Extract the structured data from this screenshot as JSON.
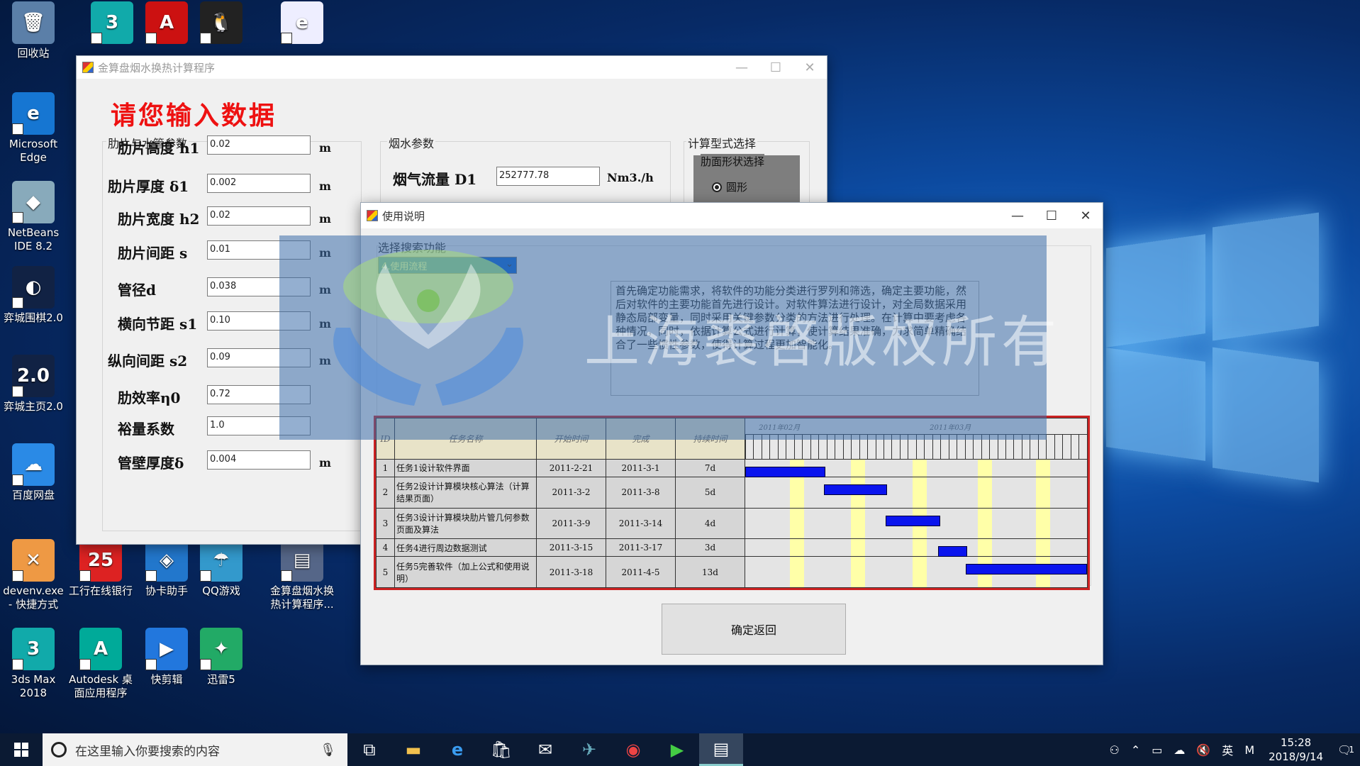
{
  "desktop": {
    "icons": [
      {
        "label": "回收站",
        "glyph": "🗑",
        "color": "#5b7fa8"
      },
      {
        "label": "",
        "glyph": "3",
        "color": "#1aa"
      },
      {
        "label": "",
        "glyph": "A",
        "color": "#c11"
      },
      {
        "label": "",
        "glyph": "🐧",
        "color": "#222"
      },
      {
        "label": "",
        "glyph": "e",
        "color": "#eef"
      },
      {
        "label": "Microsoft Edge",
        "glyph": "e",
        "color": "#1676d2"
      },
      {
        "label": "NetBeans IDE 8.2",
        "glyph": "◆",
        "color": "#8ab"
      },
      {
        "label": "弈城围棋2.0",
        "glyph": "◐",
        "color": "#124"
      },
      {
        "label": "弈城主页2.0",
        "glyph": "2.0",
        "color": "#124"
      },
      {
        "label": "百度网盘",
        "glyph": "☁",
        "color": "#2a8ae6"
      },
      {
        "label": "devenv.exe - 快捷方式",
        "glyph": "✕",
        "color": "#e94"
      },
      {
        "label": "工行在线银行",
        "glyph": "25",
        "color": "#d22"
      },
      {
        "label": "协卡助手",
        "glyph": "◈",
        "color": "#27c"
      },
      {
        "label": "QQ游戏",
        "glyph": "☂",
        "color": "#39c"
      },
      {
        "label": "金算盘烟水换热计算程序...",
        "glyph": "▤",
        "color": "#568"
      },
      {
        "label": "3ds Max 2018",
        "glyph": "3",
        "color": "#1aa"
      },
      {
        "label": "Autodesk 桌面应用程序",
        "glyph": "A",
        "color": "#0a9"
      },
      {
        "label": "快剪辑",
        "glyph": "▶",
        "color": "#27d"
      },
      {
        "label": "迅雷5",
        "glyph": "✦",
        "color": "#2a6"
      }
    ]
  },
  "main_window": {
    "title": "金算盘烟水换热计算程序",
    "heading": "请您输入数据",
    "group_fin": "肋片与水管参数",
    "group_gas": "烟水参数",
    "group_calc": "计算型式选择",
    "fields": [
      {
        "label": "肋片高度  h1",
        "value": "0.02",
        "unit": "m"
      },
      {
        "label": "肋片厚度  δ1",
        "value": "0.002",
        "unit": "m"
      },
      {
        "label": "肋片宽度  h2",
        "value": "0.02",
        "unit": "m"
      },
      {
        "label": "肋片间距  s",
        "value": "0.01",
        "unit": "m"
      },
      {
        "label": "管径d",
        "value": "0.038",
        "unit": "m"
      },
      {
        "label": "横向节距  s1",
        "value": "0.10",
        "unit": "m"
      },
      {
        "label": "纵向间距  s2",
        "value": "0.09",
        "unit": "m"
      },
      {
        "label": "肋效率η0",
        "value": "0.72",
        "unit": ""
      },
      {
        "label": "裕量系数",
        "value": "1.0",
        "unit": ""
      },
      {
        "label": "管壁厚度δ",
        "value": "0.004",
        "unit": "m"
      }
    ],
    "gas_flow": {
      "label": "烟气流量  D1",
      "value": "252777.78",
      "unit": "Nm3./h"
    },
    "fin_shape_label": "肋面形状选择",
    "radio_round": "圆形"
  },
  "help_window": {
    "title": "使用说明",
    "select_label": "选择搜索功能",
    "select_value": "4.使用流程",
    "text": "首先确定功能需求，将软件的功能分类进行罗列和筛选，确定主要功能，然后对软件的主要功能首先进行设计。对软件算法进行设计，对全局数据采用静态局部变量，同时采用关键参数分类的方法进行处理。在计算中要考虑各种情况，同时，依据计算公式进行计算，使计算结果准确，力求简单精确结合了一些惯性参数，使得计算过程更加智能化。",
    "gantt": {
      "headers": [
        "ID",
        "任务名称",
        "开始时间",
        "完成",
        "持续时间",
        "2011年02月",
        "2011年03月"
      ],
      "rows": [
        {
          "id": "1",
          "name": "任务1设计软件界面",
          "start": "2011-2-21",
          "end": "2011-3-1",
          "dur": "7d",
          "s": 0.0,
          "w": 0.235
        },
        {
          "id": "2",
          "name": "任务2设计计算模块核心算法（计算结果页面）",
          "start": "2011-3-2",
          "end": "2011-3-8",
          "dur": "5d",
          "s": 0.23,
          "w": 0.185
        },
        {
          "id": "3",
          "name": "任务3设计计算模块肋片管几何参数页面及算法",
          "start": "2011-3-9",
          "end": "2011-3-14",
          "dur": "4d",
          "s": 0.41,
          "w": 0.16
        },
        {
          "id": "4",
          "name": "任务4进行周边数据测试",
          "start": "2011-3-15",
          "end": "2011-3-17",
          "dur": "3d",
          "s": 0.565,
          "w": 0.085
        },
        {
          "id": "5",
          "name": "任务5完善软件（加上公式和使用说明）",
          "start": "2011-3-18",
          "end": "2011-4-5",
          "dur": "13d",
          "s": 0.645,
          "w": 0.355
        }
      ]
    },
    "confirm_button": "确定返回"
  },
  "watermark": "上海裘啓版权所有",
  "taskbar": {
    "search_placeholder": "在这里输入你要搜索的内容",
    "ime": "英",
    "time": "15:28",
    "date": "2018/9/14",
    "notif_count": "1"
  },
  "colors": {
    "heading": "#ee1111",
    "gantt_bar": "#0a14ee",
    "gantt_border": "#cc2222",
    "taskbar": "#0b1a33"
  }
}
